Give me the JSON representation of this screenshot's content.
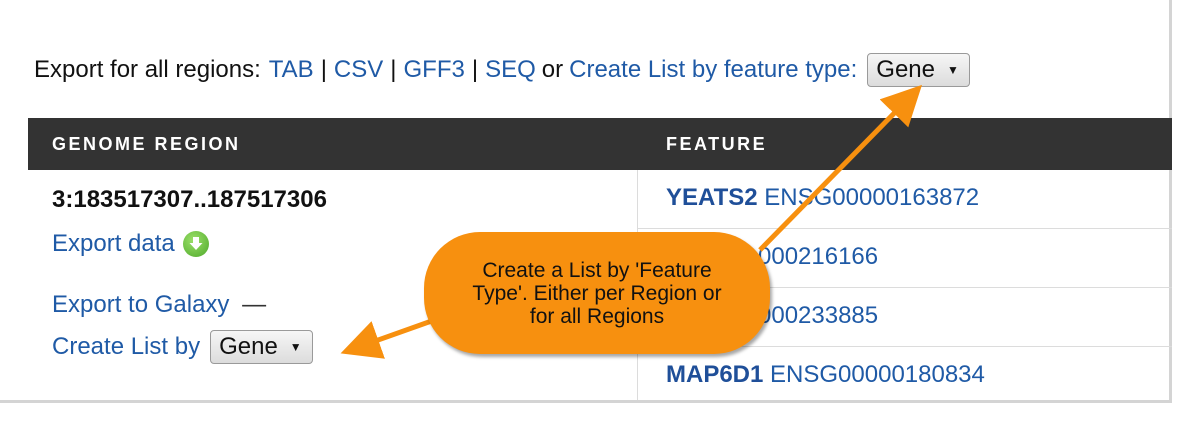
{
  "export_bar": {
    "prefix": "Export for all regions:",
    "formats": [
      "TAB",
      "CSV",
      "GFF3",
      "SEQ"
    ],
    "or_text": "or",
    "create_list_label": "Create List by feature type:",
    "feature_type_selected": "Gene"
  },
  "table": {
    "headers": {
      "region": "GENOME REGION",
      "feature": "FEATURE"
    },
    "region": {
      "coords": "3:183517307..187517306",
      "export_data": "Export data",
      "export_galaxy": "Export to Galaxy",
      "galaxy_suffix": "—",
      "create_list_label": "Create List by",
      "create_list_selected": "Gene"
    },
    "features": [
      {
        "symbol": "YEATS2",
        "id": "ENSG00000163872"
      },
      {
        "symbol": "",
        "id": "000216166"
      },
      {
        "symbol": "",
        "id": "000233885"
      },
      {
        "symbol": "MAP6D1",
        "id": "ENSG00000180834"
      }
    ]
  },
  "callout": {
    "text": "Create a List by 'Feature Type'. Either per Region or for all Regions",
    "color": "#f7900f"
  },
  "colors": {
    "link": "#1f5aa6",
    "header_bg": "#333333",
    "icon_green": "#4ea82a"
  }
}
